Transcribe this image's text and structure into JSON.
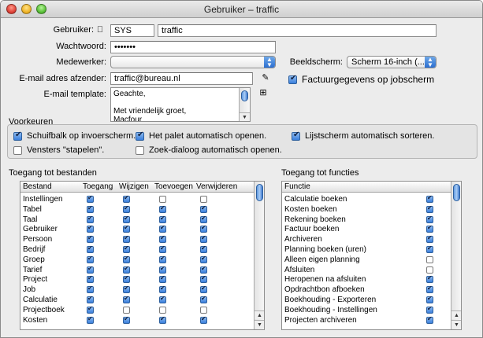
{
  "window": {
    "title": "Gebruiker – traffic"
  },
  "form": {
    "user_label": "Gebruiker:",
    "user_code": "SYS",
    "user_name": "traffic",
    "password_label": "Wachtwoord:",
    "password_value": "•••••••",
    "employee_label": "Medewerker:",
    "employee_value": "",
    "screen_label": "Beeldscherm:",
    "screen_value": "Scherm 16-inch (...",
    "email_label": "E-mail adres afzender:",
    "email_value": "traffic@bureau.nl",
    "invoice_checkbox_label": "Factuurgegevens op jobscherm",
    "invoice_checked": true,
    "template_label": "E-mail template:",
    "template_lines": [
      "Geachte,",
      "",
      "Met vriendelijk groet,",
      "Macfour"
    ]
  },
  "prefs": {
    "title": "Voorkeuren",
    "items": [
      {
        "label": "Schuifbalk op invoerscherm.",
        "checked": true
      },
      {
        "label": "Het palet automatisch openen.",
        "checked": true
      },
      {
        "label": "Lijstscherm automatisch sorteren.",
        "checked": true
      },
      {
        "label": "Vensters \"stapelen\".",
        "checked": false
      },
      {
        "label": "Zoek-dialoog automatisch openen.",
        "checked": false
      }
    ]
  },
  "files": {
    "title": "Toegang tot bestanden",
    "columns": [
      "Bestand",
      "Toegang",
      "Wijzigen",
      "Toevoegen",
      "Verwijderen"
    ],
    "rows": [
      {
        "name": "Instellingen",
        "v": [
          true,
          true,
          false,
          false
        ]
      },
      {
        "name": "Tabel",
        "v": [
          true,
          true,
          true,
          true
        ]
      },
      {
        "name": "Taal",
        "v": [
          true,
          true,
          true,
          true
        ]
      },
      {
        "name": "Gebruiker",
        "v": [
          true,
          true,
          true,
          true
        ]
      },
      {
        "name": "Persoon",
        "v": [
          true,
          true,
          true,
          true
        ]
      },
      {
        "name": "Bedrijf",
        "v": [
          true,
          true,
          true,
          true
        ]
      },
      {
        "name": "Groep",
        "v": [
          true,
          true,
          true,
          true
        ]
      },
      {
        "name": "Tarief",
        "v": [
          true,
          true,
          true,
          true
        ]
      },
      {
        "name": "Project",
        "v": [
          true,
          true,
          true,
          true
        ]
      },
      {
        "name": "Job",
        "v": [
          true,
          true,
          true,
          true
        ]
      },
      {
        "name": "Calculatie",
        "v": [
          true,
          true,
          true,
          true
        ]
      },
      {
        "name": "Projectboek",
        "v": [
          true,
          false,
          false,
          false
        ]
      },
      {
        "name": "Kosten",
        "v": [
          true,
          true,
          true,
          true
        ]
      }
    ]
  },
  "functions": {
    "title": "Toegang tot functies",
    "column": "Functie",
    "rows": [
      {
        "name": "Calculatie boeken",
        "v": true
      },
      {
        "name": "Kosten boeken",
        "v": true
      },
      {
        "name": "Rekening boeken",
        "v": true
      },
      {
        "name": "Factuur boeken",
        "v": true
      },
      {
        "name": "Archiveren",
        "v": true
      },
      {
        "name": "Planning boeken (uren)",
        "v": true
      },
      {
        "name": "Alleen eigen planning",
        "v": false
      },
      {
        "name": "Afsluiten",
        "v": false
      },
      {
        "name": "Heropenen na afsluiten",
        "v": true
      },
      {
        "name": "Opdrachtbon afboeken",
        "v": true
      },
      {
        "name": "Boekhouding - Exporteren",
        "v": true
      },
      {
        "name": "Boekhouding - Instellingen",
        "v": true
      },
      {
        "name": "Projecten archiveren",
        "v": true
      }
    ]
  }
}
